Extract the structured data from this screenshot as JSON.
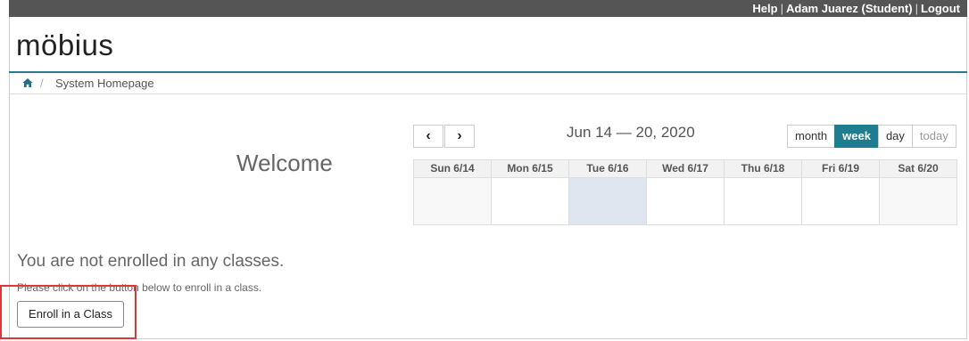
{
  "topbar": {
    "help": "Help",
    "user": "Adam Juarez (Student)",
    "logout": "Logout",
    "sep": "|"
  },
  "logo": {
    "text": "möbius"
  },
  "breadcrumb": {
    "sep": "/",
    "current": "System Homepage"
  },
  "main": {
    "welcome": "Welcome",
    "notice": "You are not enrolled in any classes.",
    "hint": "Please click on the button below to enroll in a class.",
    "enroll_label": "Enroll in a Class"
  },
  "calendar": {
    "prev": "‹",
    "next": "›",
    "range": "Jun 14 — 20, 2020",
    "views": [
      "month",
      "week",
      "day",
      "today"
    ],
    "days": [
      "Sun 6/14",
      "Mon 6/15",
      "Tue 6/16",
      "Wed 6/17",
      "Thu 6/18",
      "Fri 6/19",
      "Sat 6/20"
    ],
    "active_view": "week",
    "today_column": "Tue 6/16"
  },
  "colors": {
    "topbar": "#555555",
    "accent": "#1f7d91",
    "highlight": "#e0353a",
    "today_cell": "#dfe6f0"
  }
}
